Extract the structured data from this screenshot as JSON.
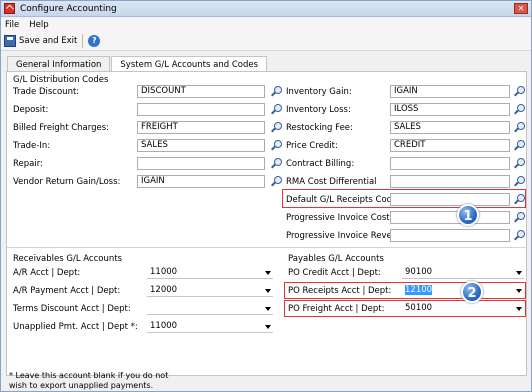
{
  "window": {
    "title": "Configure Accounting",
    "close_glyph": "✕"
  },
  "menu": [
    "File",
    "Help"
  ],
  "toolbar": {
    "save_exit": "Save and Exit",
    "help_glyph": "?"
  },
  "tabs": [
    "General Information",
    "System G/L Accounts and Codes"
  ],
  "gl_distribution": {
    "title": "G/L Distribution Codes",
    "left": [
      {
        "label": "Trade Discount:",
        "value": "DISCOUNT"
      },
      {
        "label": "Deposit:",
        "value": ""
      },
      {
        "label": "Billed Freight Charges:",
        "value": "FREIGHT"
      },
      {
        "label": "Trade-In:",
        "value": "SALES"
      },
      {
        "label": "Repair:",
        "value": ""
      },
      {
        "label": "Vendor Return Gain/Loss:",
        "value": "IGAIN"
      }
    ],
    "right": [
      {
        "label": "Inventory Gain:",
        "value": "IGAIN"
      },
      {
        "label": "Inventory Loss:",
        "value": "ILOSS"
      },
      {
        "label": "Restocking Fee:",
        "value": "SALES"
      },
      {
        "label": "Price Credit:",
        "value": "CREDIT"
      },
      {
        "label": "Contract Billing:",
        "value": ""
      },
      {
        "label": "RMA Cost Differential",
        "value": ""
      },
      {
        "label": "Default G/L Receipts Code:",
        "value": ""
      },
      {
        "label": "Progressive Invoice Cost:",
        "value": ""
      },
      {
        "label": "Progressive Invoice Revenue:",
        "value": ""
      }
    ]
  },
  "receivables": {
    "title": "Receivables G/L Accounts",
    "rows": [
      {
        "label": "A/R Acct  |  Dept:",
        "value": "11000"
      },
      {
        "label": "A/R Payment Acct  |  Dept:",
        "value": "12000"
      },
      {
        "label": "Terms Discount Acct  |  Dept:",
        "value": ""
      },
      {
        "label": "Unapplied Pmt. Acct  |  Dept *:",
        "value": "11000"
      }
    ]
  },
  "payables": {
    "title": "Payables G/L Accounts",
    "rows": [
      {
        "label": "PO Credit Acct  |  Dept:",
        "value": "90100"
      },
      {
        "label": "PO Receipts Acct  |  Dept:",
        "value": "12100"
      },
      {
        "label": "PO Freight Acct  |  Dept:",
        "value": "50100"
      }
    ]
  },
  "callouts": [
    "1",
    "2"
  ],
  "footnote": [
    "* Leave this account blank if you do not",
    "wish to export unapplied payments."
  ],
  "colors": {
    "highlight": "#e23636",
    "selection": "#3399ff"
  }
}
